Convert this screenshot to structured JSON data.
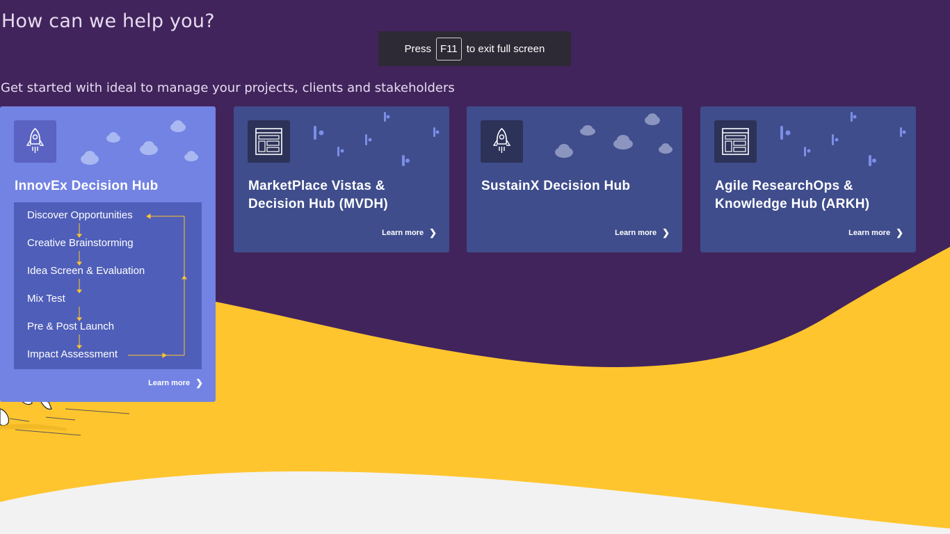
{
  "header": {
    "title": "How can we help you?",
    "subtitle": "Get started with ideal to manage your projects, clients and stakeholders"
  },
  "fullscreen_notice": {
    "prefix": "Press",
    "key": "F11",
    "suffix": "to exit full screen"
  },
  "cards": [
    {
      "title": "InnovEx Decision Hub",
      "icon": "rocket-icon",
      "learn_more": "Learn more",
      "steps": [
        "Discover Opportunities",
        "Creative Brainstorming",
        "Idea Screen & Evaluation",
        "Mix Test",
        "Pre & Post Launch",
        "Impact Assessment"
      ]
    },
    {
      "title": "MarketPlace Vistas & Decision Hub (MVDH)",
      "icon": "dashboard-layout-icon",
      "learn_more": "Learn more"
    },
    {
      "title": "SustainX Decision Hub",
      "icon": "rocket-icon",
      "learn_more": "Learn more"
    },
    {
      "title": "Agile  ResearchOps & Knowledge Hub (ARKH)",
      "icon": "dashboard-layout-icon",
      "learn_more": "Learn more"
    }
  ],
  "colors": {
    "background_purple": "#42245c",
    "wave_yellow": "#ffc52e",
    "footer_gray": "#f2f2f2",
    "card_blue": "#3f4d8c",
    "card_active": "#7383e3",
    "process_box": "#4f5eb8",
    "arrow_yellow": "#ffc52e"
  }
}
